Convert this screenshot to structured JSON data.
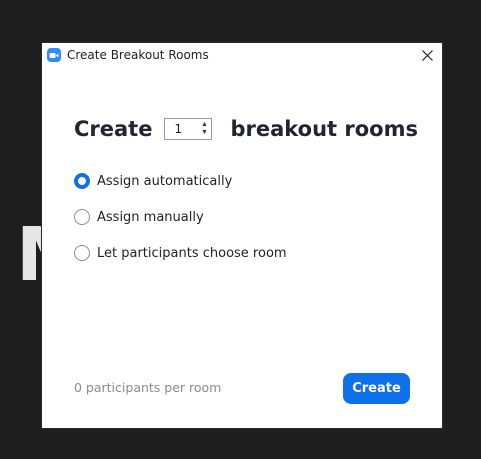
{
  "window": {
    "title": "Create Breakout Rooms",
    "app_icon": "zoom-camera-icon",
    "close_icon": "close-icon"
  },
  "create_row": {
    "prefix": "Create",
    "count_value": "1",
    "suffix": "breakout rooms"
  },
  "assign_options": [
    {
      "label": "Assign automatically",
      "selected": true
    },
    {
      "label": "Assign manually",
      "selected": false
    },
    {
      "label": "Let participants choose room",
      "selected": false
    }
  ],
  "footer": {
    "participants_per_room": "0 participants per room",
    "create_button_label": "Create"
  },
  "background": {
    "partial_glyph": "M"
  },
  "colors": {
    "accent": "#0e71eb",
    "zoom_blue": "#2d8cff",
    "backdrop": "#1e1e1e",
    "muted_text": "#8a8a94"
  }
}
